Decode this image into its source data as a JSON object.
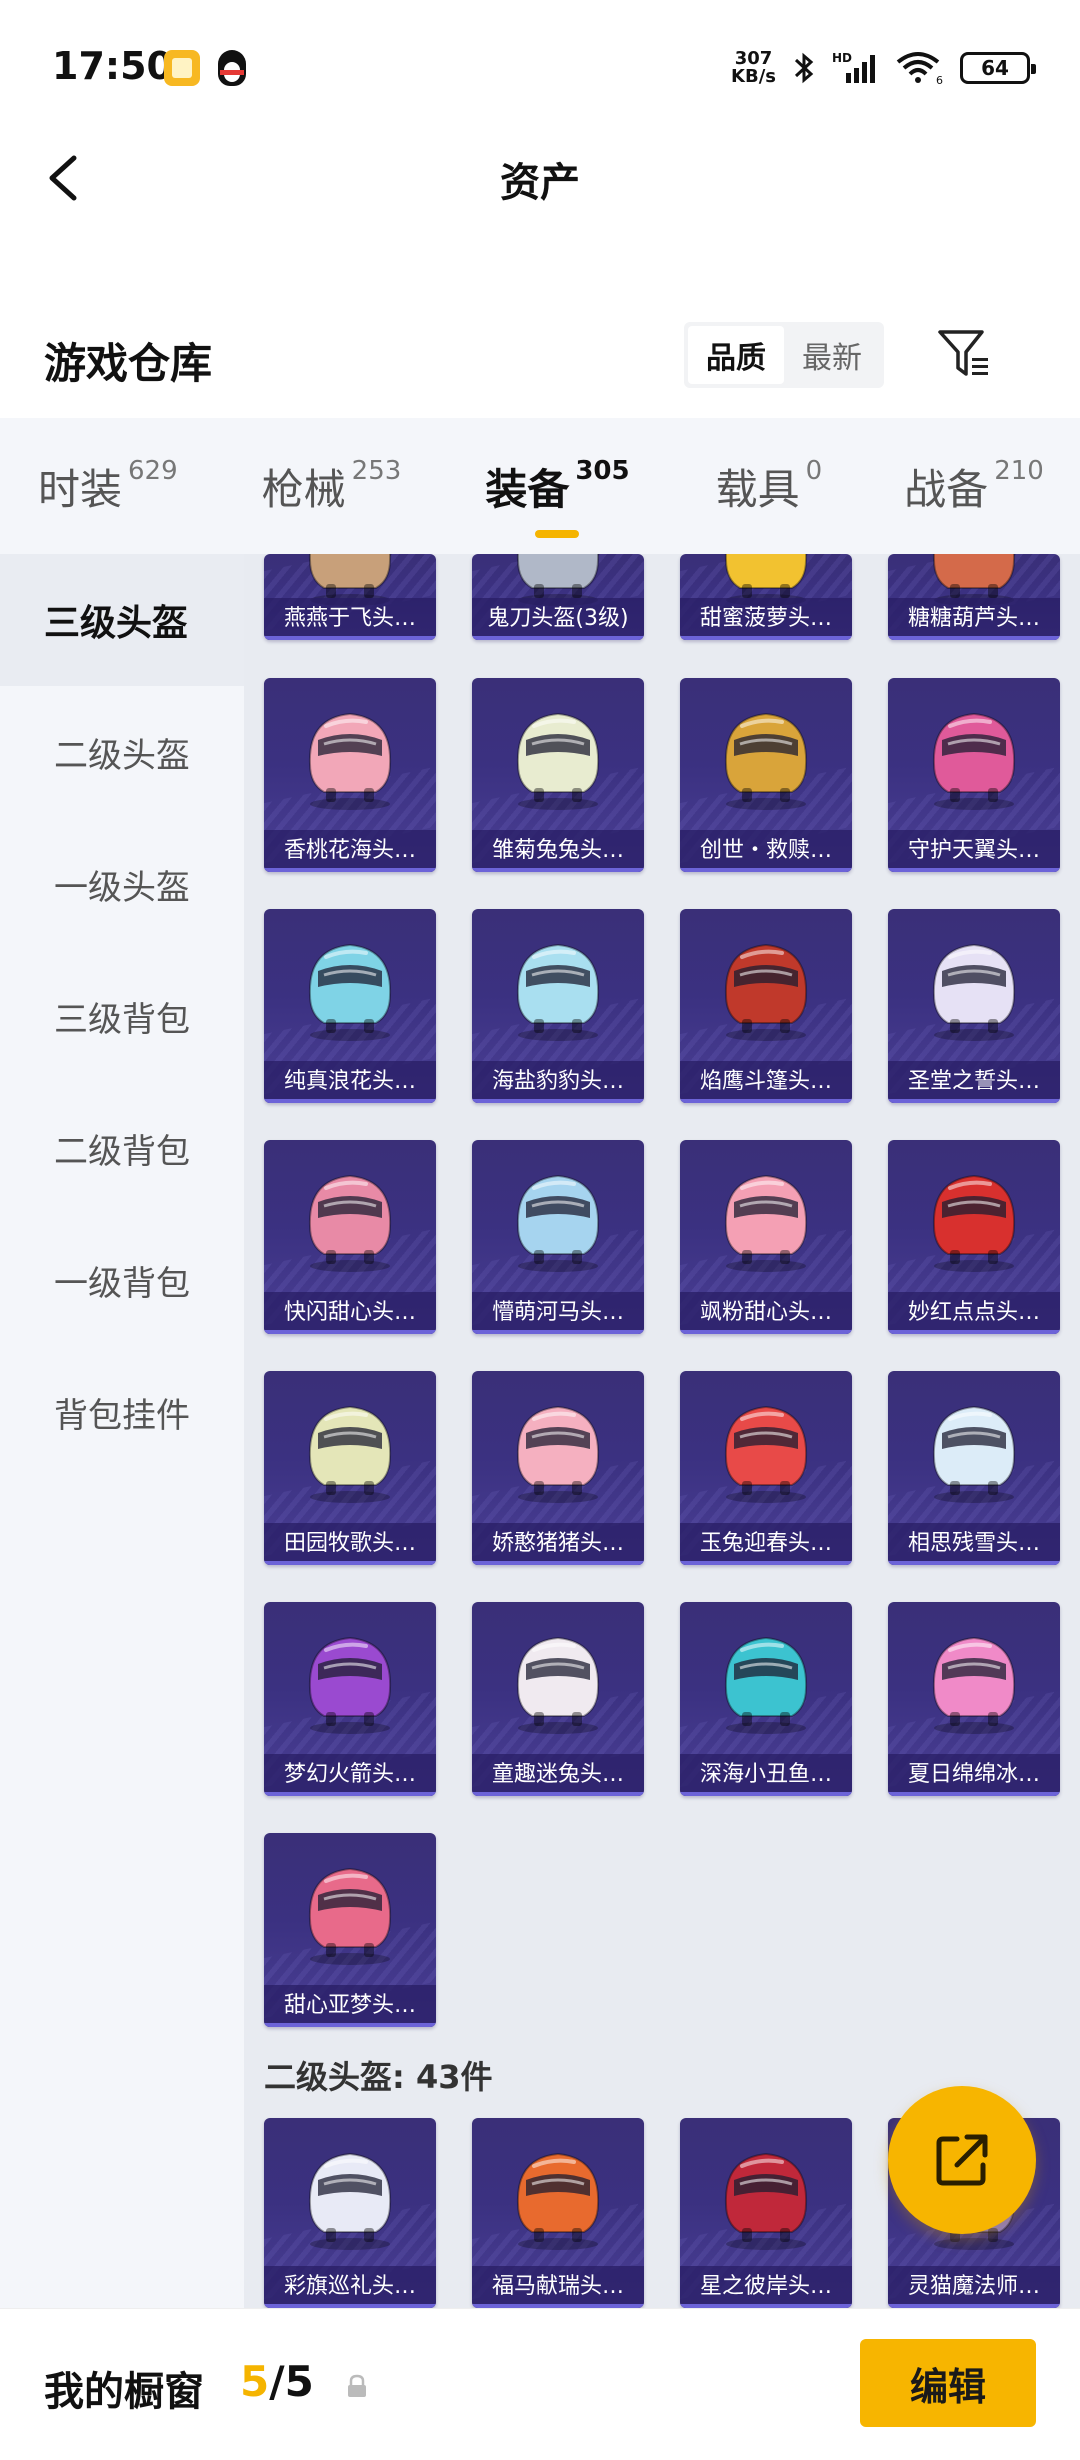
{
  "status_bar": {
    "time": "17:50",
    "net_speed_value": "307",
    "net_speed_unit": "KB/s",
    "network": "HD",
    "wifi_num": "6",
    "battery": "64"
  },
  "nav": {
    "title": "资产"
  },
  "warehouse": {
    "title": "游戏仓库",
    "sort_options": [
      "品质",
      "最新"
    ],
    "sort_active": "品质"
  },
  "tabs": [
    {
      "label": "时装",
      "count": "629"
    },
    {
      "label": "枪械",
      "count": "253"
    },
    {
      "label": "装备",
      "count": "305",
      "active": true
    },
    {
      "label": "载具",
      "count": "0"
    },
    {
      "label": "战备",
      "count": "210"
    }
  ],
  "sidebar": [
    {
      "label": "三级头盔",
      "active": true
    },
    {
      "label": "二级头盔"
    },
    {
      "label": "一级头盔"
    },
    {
      "label": "三级背包"
    },
    {
      "label": "二级背包"
    },
    {
      "label": "一级背包"
    },
    {
      "label": "背包挂件"
    }
  ],
  "items_level3": [
    {
      "name": "燕燕于飞头…",
      "color": "#c8a07a"
    },
    {
      "name": "鬼刀头盔(3级)",
      "color": "#b0b8c8"
    },
    {
      "name": "甜蜜菠萝头…",
      "color": "#f2c230"
    },
    {
      "name": "糖糖葫芦头…",
      "color": "#d46a4a"
    },
    {
      "name": "香桃花海头…",
      "color": "#f2a7b8"
    },
    {
      "name": "雏菊兔兔头…",
      "color": "#e8ecd0"
    },
    {
      "name": "创世・救赎…",
      "color": "#d9a43a"
    },
    {
      "name": "守护天翼头…",
      "color": "#e05a9a"
    },
    {
      "name": "纯真浪花头…",
      "color": "#7fd3e6"
    },
    {
      "name": "海盐豹豹头…",
      "color": "#a9dff0"
    },
    {
      "name": "焰鹰斗篷头…",
      "color": "#c0392b"
    },
    {
      "name": "圣堂之誓头…",
      "color": "#e6e1f5"
    },
    {
      "name": "快闪甜心头…",
      "color": "#e88aa6"
    },
    {
      "name": "懵萌河马头…",
      "color": "#a6d4ef"
    },
    {
      "name": "飒粉甜心头…",
      "color": "#f4a0b4"
    },
    {
      "name": "妙红点点头…",
      "color": "#d8302e"
    },
    {
      "name": "田园牧歌头…",
      "color": "#e4e6b8"
    },
    {
      "name": "娇憨猪猪头…",
      "color": "#f5b0c0"
    },
    {
      "name": "玉兔迎春头…",
      "color": "#e84a48"
    },
    {
      "name": "相思残雪头…",
      "color": "#dcecf8"
    },
    {
      "name": "梦幻火箭头…",
      "color": "#9a4ad0"
    },
    {
      "name": "童趣迷兔头…",
      "color": "#f0eaf0"
    },
    {
      "name": "深海小丑鱼…",
      "color": "#3cc3d0"
    },
    {
      "name": "夏日绵绵冰…",
      "color": "#f08ac8"
    },
    {
      "name": "甜心亚梦头…",
      "color": "#e86a8a"
    }
  ],
  "section_level2": {
    "title": "二级头盔: 43件"
  },
  "items_level2": [
    {
      "name": "彩旗巡礼头…",
      "color": "#e8eaf6"
    },
    {
      "name": "福马献瑞头…",
      "color": "#e86a2e"
    },
    {
      "name": "星之彼岸头…",
      "color": "#c0283a"
    },
    {
      "name": "灵猫魔法师…",
      "color": "#8a7ad0"
    }
  ],
  "bottom_bar": {
    "title": "我的橱窗",
    "count_current": "5",
    "count_sep_total": "/5",
    "edit_label": "编辑"
  }
}
